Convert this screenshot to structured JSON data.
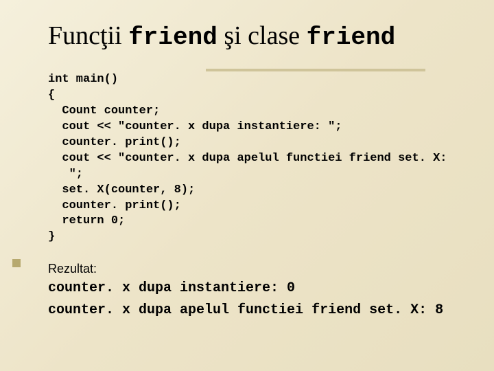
{
  "title": {
    "part1": "Funcţii ",
    "mono1": "friend",
    "part2": " şi clase ",
    "mono2": "friend"
  },
  "code": "int main()\n{\n  Count counter;\n  cout << \"counter. x dupa instantiere: \";\n  counter. print();\n  cout << \"counter. x dupa apelul functiei friend set. X:\n   \";\n  set. X(counter, 8);\n  counter. print();\n  return 0;\n}",
  "result_label": "Rezultat:",
  "result_line1": "counter. x dupa instantiere: 0",
  "result_line2": "counter. x dupa apelul functiei friend set. X: 8"
}
